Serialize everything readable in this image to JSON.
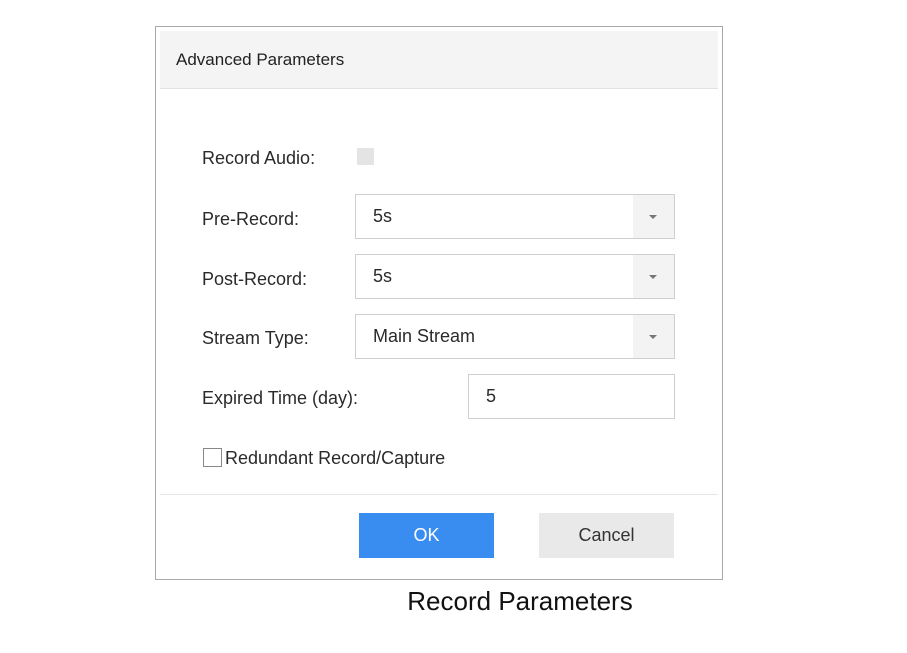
{
  "dialog": {
    "title": "Advanced Parameters",
    "record_audio": {
      "label": "Record Audio:",
      "checked": false
    },
    "pre_record": {
      "label": "Pre-Record:",
      "value": "5s"
    },
    "post_record": {
      "label": "Post-Record:",
      "value": "5s"
    },
    "stream_type": {
      "label": "Stream Type:",
      "value": "Main Stream"
    },
    "expired_time": {
      "label": "Expired Time (day):",
      "value": "5"
    },
    "redundant": {
      "label": "Redundant Record/Capture",
      "checked": false
    },
    "buttons": {
      "ok": "OK",
      "cancel": "Cancel"
    }
  },
  "caption": "Record Parameters",
  "colors": {
    "ok_button": "#3a8df0",
    "cancel_button": "#e9e9e9",
    "title_bar": "#f4f4f4"
  },
  "icons": {
    "dropdown": "caret-down-icon"
  }
}
